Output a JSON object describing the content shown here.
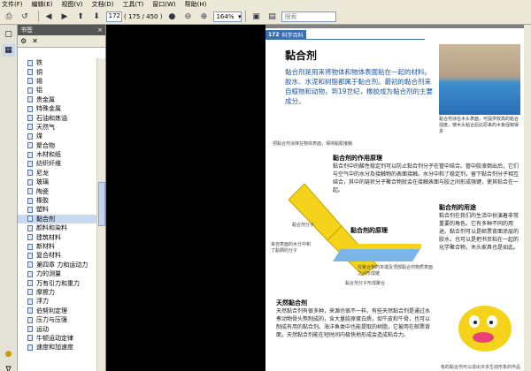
{
  "menu": [
    "文件(F)",
    "编辑(E)",
    "视图(V)",
    "文档(D)",
    "工具(T)",
    "窗口(W)",
    "帮助(H)"
  ],
  "toolbar": {
    "page_current": "172",
    "page_count": "( 175 / 450 )",
    "zoom": "164%",
    "search_placeholder": "搜索"
  },
  "bookmarks": {
    "title": "书签",
    "items": [
      "铁",
      "铜",
      "锡",
      "铝",
      "贵金属",
      "特殊金属",
      "石油和炼油",
      "天然气",
      "煤",
      "聚合物",
      "木材和纸",
      "纺织纤维",
      "尼龙",
      "玻璃",
      "陶瓷",
      "橡胶",
      "塑料",
      "黏合剂",
      "颜料和染料",
      "建筑材料",
      "新材料",
      "复合材料",
      "第四章 力和运动力",
      "力的测量",
      "万有引力和重力",
      "摩擦力",
      "浮力",
      "伯努利定理",
      "压力与压强",
      "运动",
      "牛顿运动定律",
      "速度和加速度"
    ],
    "selected_index": 17
  },
  "page": {
    "header_num": "172",
    "header_section": "科学百科",
    "title": "黏合剂",
    "intro": "黏合剂是用来将物体和物体表面粘在一起的材料。胶水、水泥和树脂都属于黏合剂。最初的黏合剂来自植物和动物，到19世纪，橡胶成为黏合剂的主要成分。",
    "caption_top": "黏合剂涂在木头表面，可提供较高的粘合强度，使木头粘合后比原来的木板强韧得多",
    "diagram_note": "把黏合剂涂抹在物体表面，保持黏胶接触",
    "sec1_title": "黏合剂的作用原理",
    "sec1_body": "黏合剂中的酸性稳定剂可以防止黏合剂分子在管中结合。管中胶液倒出后，它们与空气中的水分及接触物的表面接触。水分中和了稳定剂，留下黏合剂分子相互结合，其中的链状分子聚合物就会在接触表面与胶之间形成强键，使其粘合在一起。",
    "label_chain": "黏合剂分子",
    "label_surface": "来自表面的水分中和了黏稠的分子",
    "sec2_title": "黏合剂的原理",
    "label_bond": "黏合剂分子形成聚合",
    "label_polymer": "在聚合物的末端及顶部黏合剂物质表面之间形成键",
    "sec3_title": "黏合剂的用途",
    "sec3_body": "黏合剂在我们的生活中扮演着非常重要的角色。它有多种不同的用途。黏合剂可以是邮票背面涂层的胶水，也可以是把书页粘在一起的化学聚合物，木头家具也是如此。",
    "sec4_title": "天然黏合剂",
    "sec4_body": "天然黏合剂有很多种，来源也很不一样。有些天然黏合剂是通过水煮动物骨头熬制成的，含大量胶原蛋白质，如牛皮和牛骨，也可以制成有用的黏合剂。海洋鱼类中也能提取的树脂，它被用在邮票背面，天然黏合剂能在短时间内极快地形成会造成粘合力。",
    "footcap": "有的黏合剂可以造出许多生动形象的作品"
  },
  "colors": {
    "accent": "#3a6fb0",
    "intro_text": "#1a55a0",
    "glue": "#f5d31a"
  }
}
